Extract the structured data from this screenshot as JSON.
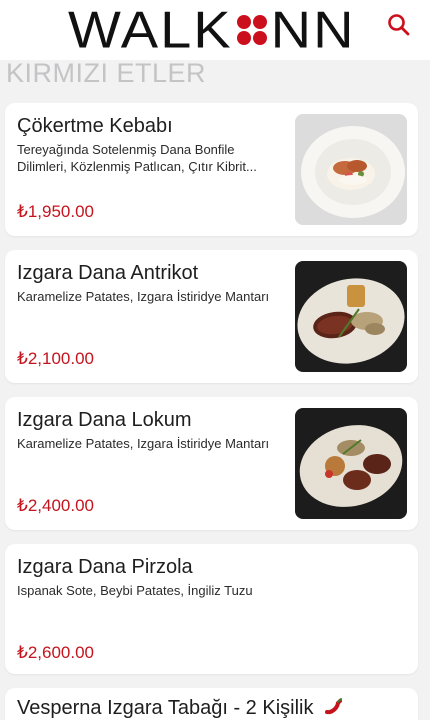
{
  "brand": {
    "logo_left": "WALK",
    "logo_right": "NN",
    "accent": "#cc0f1c"
  },
  "header": {
    "search_icon": "search-icon"
  },
  "section": {
    "title": "KIRMIZI ETLER"
  },
  "items": [
    {
      "name": "Çökertme Kebabı",
      "description": "Tereyağında Sotelenmiş Dana Bonfile Dilimleri, Közlenmiş Patlıcan, Çıtır Kibrit...",
      "price": "₺1,950.00",
      "image": "dish-photo-light"
    },
    {
      "name": "Izgara Dana Antrikot",
      "description": "Karamelize Patates, Izgara İstiridye Mantarı",
      "price": "₺2,100.00",
      "image": "dish-photo-dark"
    },
    {
      "name": "Izgara Dana Lokum",
      "description": "Karamelize Patates, Izgara İstiridye Mantarı",
      "price": "₺2,400.00",
      "image": "dish-photo-dark"
    },
    {
      "name": "Izgara Dana Pirzola",
      "description": "Ispanak Sote, Beybi Patates, İngiliz Tuzu",
      "price": "₺2,600.00",
      "image": ""
    },
    {
      "name": "Vesperna Izgara Tabağı - 2 Kişilik",
      "badge_icon": "chili-pepper-icon"
    }
  ]
}
